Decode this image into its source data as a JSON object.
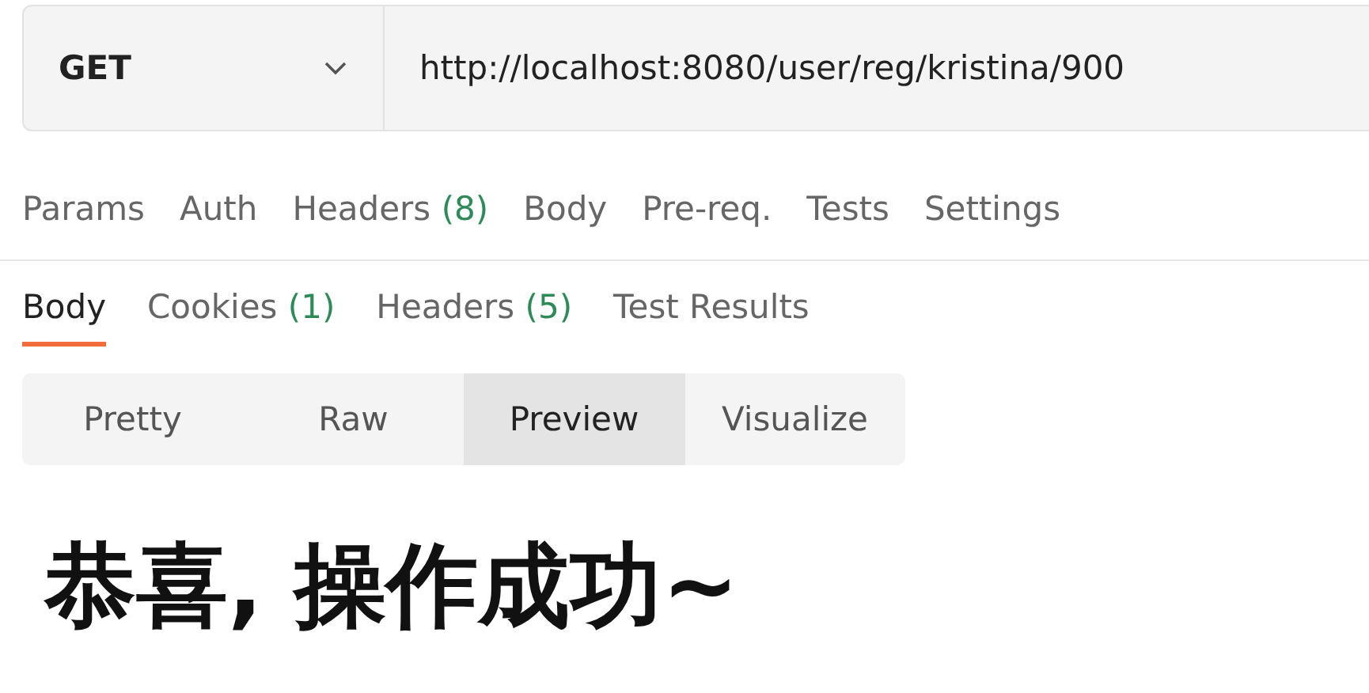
{
  "request": {
    "method": "GET",
    "url": "http://localhost:8080/user/reg/kristina/900"
  },
  "request_tabs": [
    {
      "label": "Params",
      "selected": false
    },
    {
      "label": "Auth",
      "selected": false
    },
    {
      "label": "Headers",
      "count": "(8)",
      "selected": false
    },
    {
      "label": "Body",
      "selected": false
    },
    {
      "label": "Pre-req.",
      "selected": false
    },
    {
      "label": "Tests",
      "selected": false
    },
    {
      "label": "Settings",
      "selected": false
    }
  ],
  "response_tabs": [
    {
      "label": "Body",
      "selected": true
    },
    {
      "label": "Cookies",
      "count": "(1)",
      "selected": false
    },
    {
      "label": "Headers",
      "count": "(5)",
      "selected": false
    },
    {
      "label": "Test Results",
      "selected": false
    }
  ],
  "view_modes": [
    {
      "label": "Pretty",
      "selected": false
    },
    {
      "label": "Raw",
      "selected": false
    },
    {
      "label": "Preview",
      "selected": true
    },
    {
      "label": "Visualize",
      "selected": false
    }
  ],
  "preview": {
    "heading": "恭喜, 操作成功~"
  }
}
